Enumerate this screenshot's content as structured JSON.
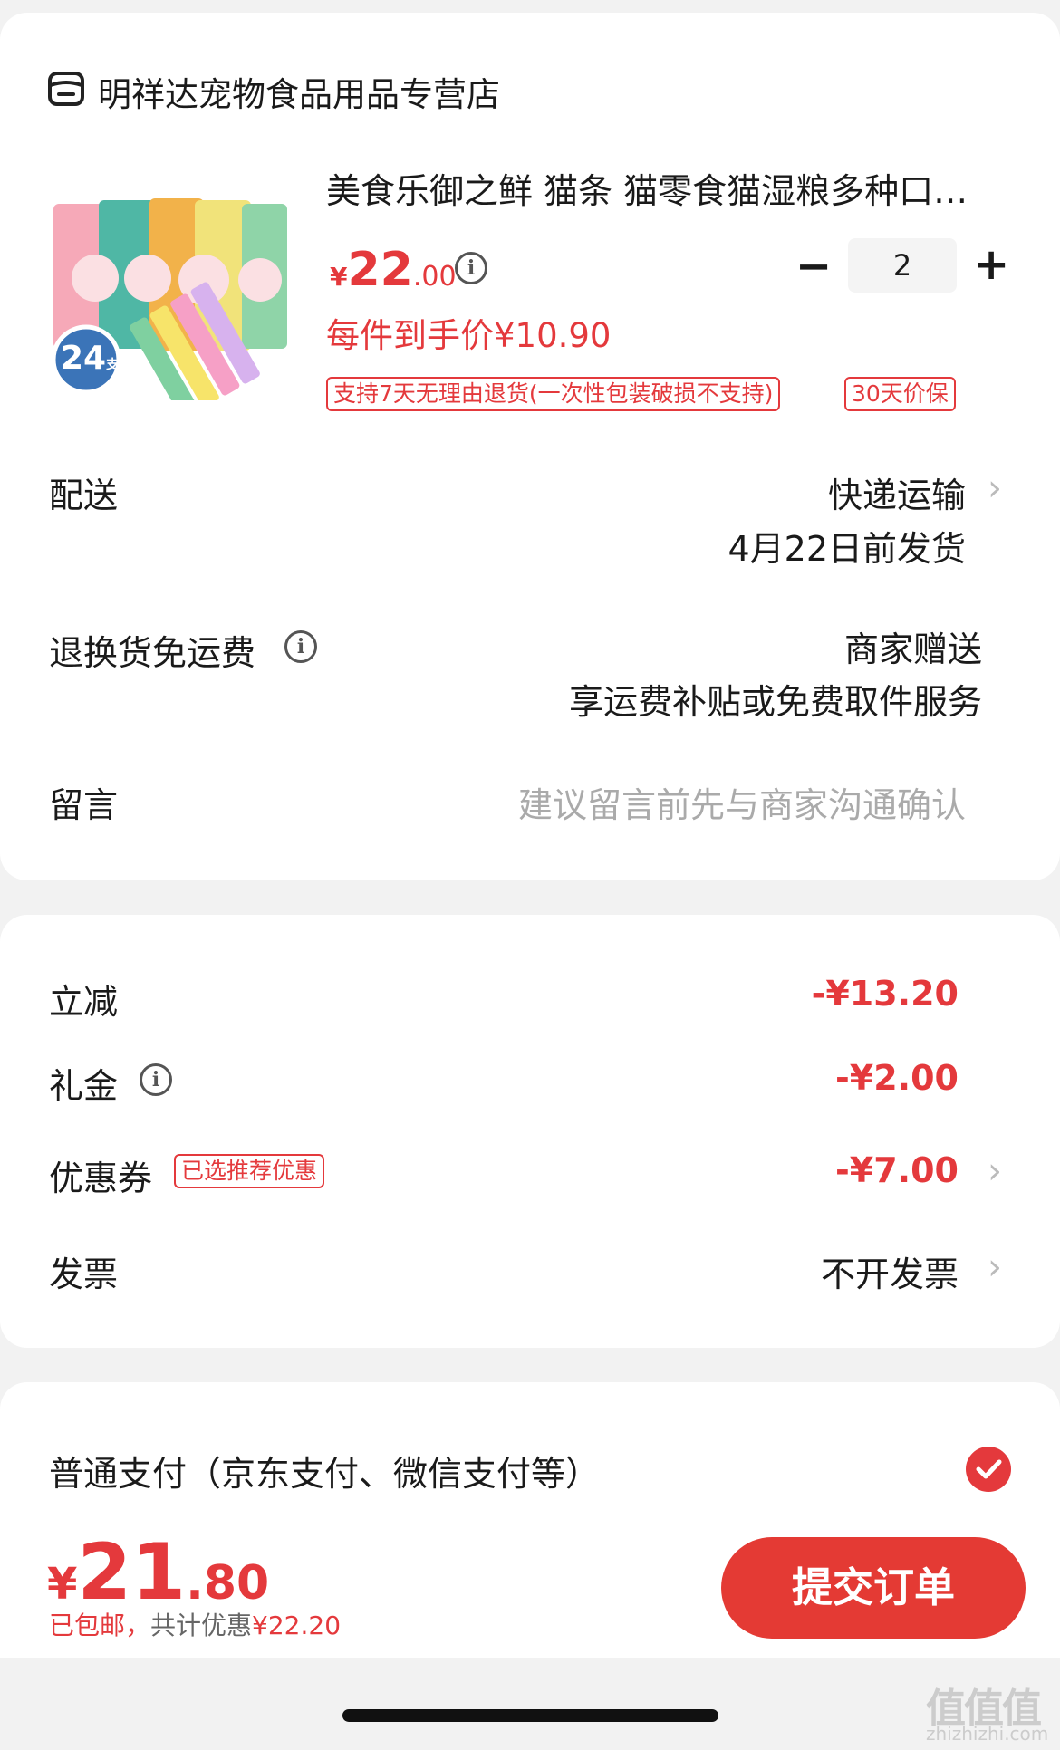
{
  "store": {
    "name": "明祥达宠物食品用品专营店",
    "icon": "store-icon"
  },
  "product": {
    "title": "美食乐御之鲜 猫条 猫零食猫湿粮多种口…",
    "price_symbol": "¥",
    "price_int": "22",
    "price_dec": ".00",
    "unit_price": "每件到手价¥10.90",
    "image_badge": "24",
    "image_badge_unit": "支",
    "quantity": "2",
    "tags": [
      "支持7天无理由退货(一次性包装破损不支持)",
      "30天价保"
    ]
  },
  "delivery": {
    "label": "配送",
    "method": "快递运输",
    "date": "4月22日前发货"
  },
  "return_shipping": {
    "label": "退换货免运费",
    "line1": "商家赠送",
    "line2": "享运费补贴或免费取件服务"
  },
  "message": {
    "label": "留言",
    "placeholder": "建议留言前先与商家沟通确认"
  },
  "discounts": {
    "instant_label": "立减",
    "instant_value": "-¥13.20",
    "gift_label": "礼金",
    "gift_value": "-¥2.00",
    "coupon_label": "优惠券",
    "coupon_tag": "已选推荐优惠",
    "coupon_value": "-¥7.00",
    "invoice_label": "发票",
    "invoice_value": "不开发票"
  },
  "payment": {
    "label": "普通支付（京东支付、微信支付等）",
    "selected": true
  },
  "footer": {
    "symbol": "¥",
    "total_int": "21",
    "total_dec": ".80",
    "shipping_note": "已包邮，",
    "saving_prefix": "共计优惠",
    "saving_value": "¥22.20",
    "submit_label": "提交订单"
  },
  "watermark": {
    "text": "值值值",
    "sub": "zhizhizhi.com"
  },
  "colors": {
    "accent": "#e4393c",
    "background": "#f2f2f2"
  }
}
